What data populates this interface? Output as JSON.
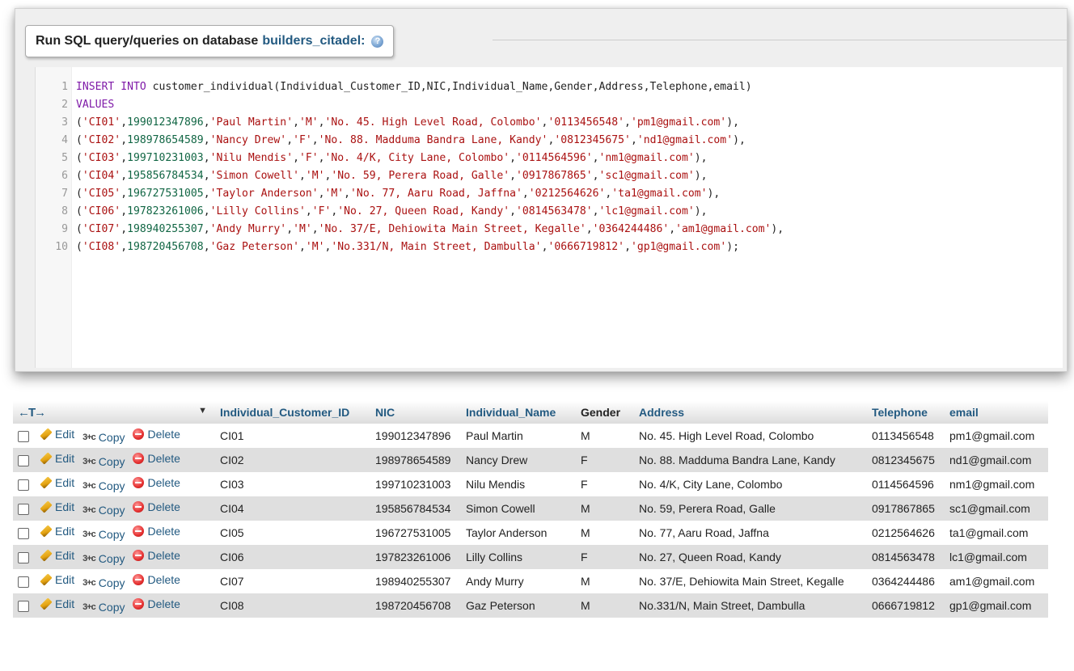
{
  "panel": {
    "title_prefix": "Run SQL query/queries on database",
    "database": "builders_citadel:",
    "help_icon": "help-icon"
  },
  "editor": {
    "lines": [
      {
        "n": "1",
        "text": "INSERT INTO customer_individual(Individual_Customer_ID,NIC,Individual_Name,Gender,Address,Telephone,email)"
      },
      {
        "n": "2",
        "text": "VALUES"
      },
      {
        "n": "3",
        "text": "('CI01',199012347896,'Paul Martin','M','No. 45. High Level Road, Colombo','0113456548','pm1@gmail.com'),"
      },
      {
        "n": "4",
        "text": "('CI02',198978654589,'Nancy Drew','F','No. 88. Madduma Bandra Lane, Kandy','0812345675','nd1@gmail.com'),"
      },
      {
        "n": "5",
        "text": "('CI03',199710231003,'Nilu Mendis','F','No. 4/K, City Lane, Colombo','0114564596','nm1@gmail.com'),"
      },
      {
        "n": "6",
        "text": "('CI04',195856784534,'Simon Cowell','M','No. 59, Perera Road, Galle','0917867865','sc1@gmail.com'),"
      },
      {
        "n": "7",
        "text": "('CI05',196727531005,'Taylor Anderson','M','No. 77, Aaru Road, Jaffna','0212564626','ta1@gmail.com'),"
      },
      {
        "n": "8",
        "text": "('CI06',197823261006,'Lilly Collins','F','No. 27, Queen Road, Kandy','0814563478','lc1@gmail.com'),"
      },
      {
        "n": "9",
        "text": "('CI07',198940255307,'Andy Murry','M','No. 37/E, Dehiowita Main Street, Kegalle','0364244486','am1@gmail.com'),"
      },
      {
        "n": "10",
        "text": "('CI08',198720456708,'Gaz Peterson','M','No.331/N, Main Street, Dambulla','0666719812','gp1@gmail.com');"
      }
    ]
  },
  "grid": {
    "nav_arrows": "←T→",
    "columns": [
      "Individual_Customer_ID",
      "NIC",
      "Individual_Name",
      "Gender",
      "Address",
      "Telephone",
      "email"
    ],
    "actions": {
      "edit": "Edit",
      "copy": "Copy",
      "delete": "Delete"
    },
    "rows": [
      [
        "CI01",
        "199012347896",
        "Paul Martin",
        "M",
        "No. 45. High Level Road, Colombo",
        "0113456548",
        "pm1@gmail.com"
      ],
      [
        "CI02",
        "198978654589",
        "Nancy Drew",
        "F",
        "No. 88. Madduma Bandra Lane, Kandy",
        "0812345675",
        "nd1@gmail.com"
      ],
      [
        "CI03",
        "199710231003",
        "Nilu Mendis",
        "F",
        "No. 4/K, City Lane, Colombo",
        "0114564596",
        "nm1@gmail.com"
      ],
      [
        "CI04",
        "195856784534",
        "Simon Cowell",
        "M",
        "No. 59, Perera Road, Galle",
        "0917867865",
        "sc1@gmail.com"
      ],
      [
        "CI05",
        "196727531005",
        "Taylor Anderson",
        "M",
        "No. 77, Aaru Road, Jaffna",
        "0212564626",
        "ta1@gmail.com"
      ],
      [
        "CI06",
        "197823261006",
        "Lilly Collins",
        "F",
        "No. 27, Queen Road, Kandy",
        "0814563478",
        "lc1@gmail.com"
      ],
      [
        "CI07",
        "198940255307",
        "Andy Murry",
        "M",
        "No. 37/E, Dehiowita Main Street, Kegalle",
        "0364244486",
        "am1@gmail.com"
      ],
      [
        "CI08",
        "198720456708",
        "Gaz Peterson",
        "M",
        "No.331/N, Main Street, Dambulla",
        "0666719812",
        "gp1@gmail.com"
      ]
    ]
  },
  "colors": {
    "link": "#235a81",
    "keyword": "#7f1aa8",
    "string": "#aa1111",
    "number": "#116644",
    "row_alt": "#dfdfdf"
  }
}
